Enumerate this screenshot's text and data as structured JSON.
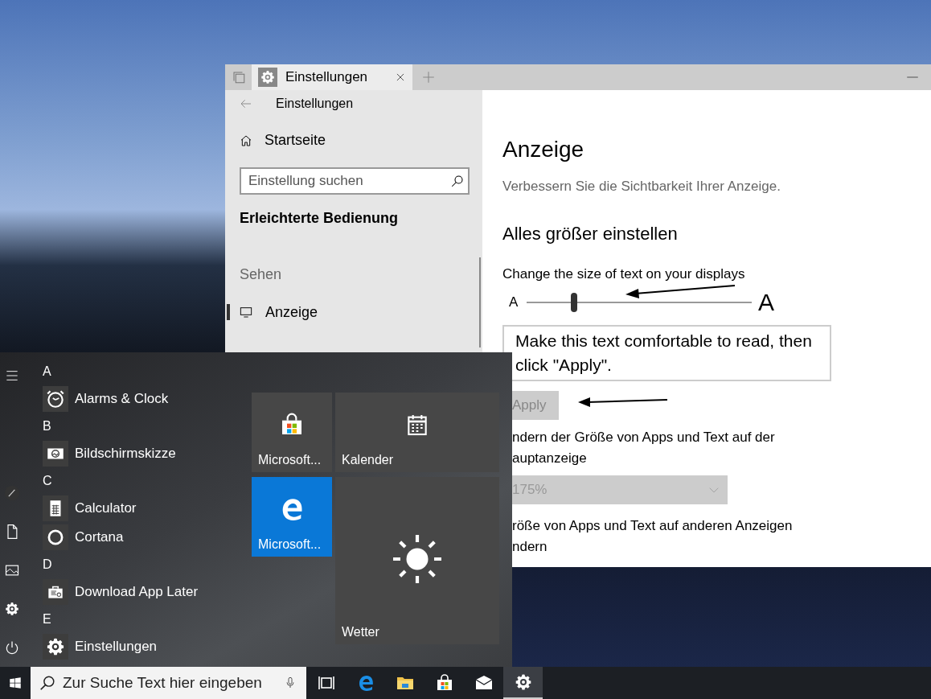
{
  "settings_window": {
    "tab": {
      "title": "Einstellungen"
    },
    "nav": {
      "title": "Einstellungen",
      "home": "Startseite",
      "search": {
        "placeholder": "Einstellung suchen"
      },
      "section": "Erleichterte Bedienung",
      "group": "Sehen",
      "items": [
        {
          "label": "Anzeige",
          "selected": true
        }
      ]
    },
    "content": {
      "title": "Anzeige",
      "subtitle": "Verbessern Sie die Sichtbarkeit Ihrer Anzeige.",
      "heading": "Alles größer einstellen",
      "text_size": {
        "label": "Change the size of text on your displays",
        "small_letter": "A",
        "large_letter": "A",
        "level": 0.21
      },
      "sample_text": "Make this text comfortable to read, then click \"Apply\".",
      "apply_button": {
        "label": "Apply",
        "disabled": true
      },
      "scale_label_lines": [
        "ndern der Größe von Apps und Text auf der",
        "auptanzeige"
      ],
      "scale_dropdown": {
        "value": "175%",
        "disabled": true
      },
      "other_label_lines": [
        "röße von Apps und Text auf anderen Anzeigen",
        "ndern"
      ]
    }
  },
  "start_menu": {
    "groups": [
      {
        "letter": "A",
        "items": [
          {
            "label": "Alarms & Clock",
            "kind": "clock"
          }
        ]
      },
      {
        "letter": "B",
        "items": [
          {
            "label": "Bildschirmskizze",
            "kind": "sketch"
          }
        ]
      },
      {
        "letter": "C",
        "items": [
          {
            "label": "Calculator",
            "kind": "calculator"
          },
          {
            "label": "Cortana",
            "kind": "cortana"
          }
        ]
      },
      {
        "letter": "D",
        "items": [
          {
            "label": "Download App Later",
            "kind": "download"
          }
        ]
      },
      {
        "letter": "E",
        "items": [
          {
            "label": "Einstellungen",
            "kind": "gear"
          }
        ]
      }
    ],
    "tiles": [
      {
        "label": "Microsoft...",
        "kind": "store"
      },
      {
        "label": "Kalender",
        "kind": "calendar"
      },
      {
        "label": "Microsoft...",
        "kind": "edge"
      },
      {
        "label": "Wetter",
        "kind": "weather"
      }
    ]
  },
  "taskbar": {
    "search": {
      "placeholder": "Zur Suche Text hier eingeben"
    },
    "apps": [
      {
        "kind": "task_view",
        "active": false
      },
      {
        "kind": "edge",
        "active": false
      },
      {
        "kind": "explorer",
        "active": false
      },
      {
        "kind": "store",
        "active": false
      },
      {
        "kind": "mail",
        "active": false
      },
      {
        "kind": "settings",
        "active": true
      }
    ]
  }
}
